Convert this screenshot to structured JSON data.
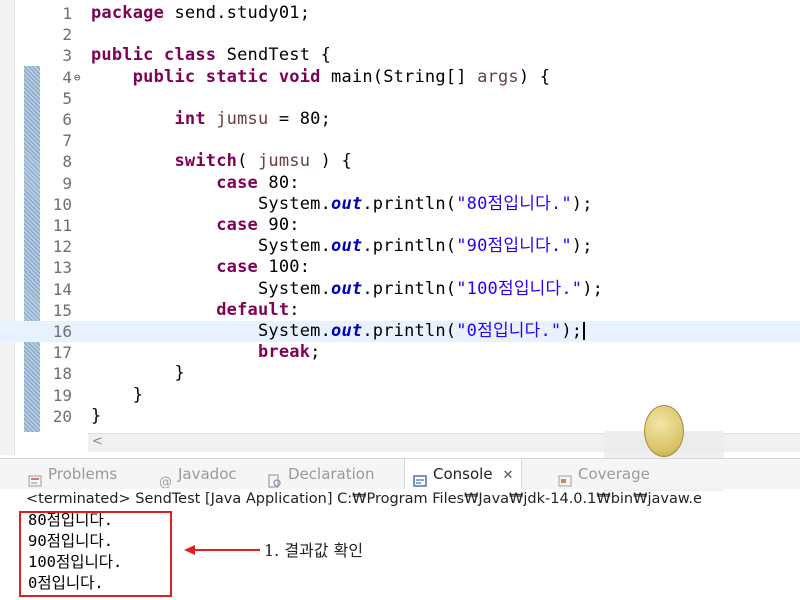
{
  "editor": {
    "lines": [
      {
        "n": "1",
        "segs": [
          {
            "t": "package ",
            "c": "kw"
          },
          {
            "t": "send.study01;",
            "c": ""
          }
        ]
      },
      {
        "n": "2",
        "segs": []
      },
      {
        "n": "3",
        "segs": [
          {
            "t": "public class ",
            "c": "kw"
          },
          {
            "t": "SendTest {",
            "c": ""
          }
        ]
      },
      {
        "n": "4",
        "fold": "⊖",
        "segs": [
          {
            "t": "    public static void ",
            "c": "kw"
          },
          {
            "t": "main(String[] ",
            "c": ""
          },
          {
            "t": "args",
            "c": "var"
          },
          {
            "t": ") {",
            "c": ""
          }
        ]
      },
      {
        "n": "5",
        "segs": []
      },
      {
        "n": "6",
        "segs": [
          {
            "t": "        int ",
            "c": "kw"
          },
          {
            "t": "jumsu",
            "c": "var"
          },
          {
            "t": " = 80;",
            "c": ""
          }
        ]
      },
      {
        "n": "7",
        "segs": []
      },
      {
        "n": "8",
        "segs": [
          {
            "t": "        switch",
            "c": "kw"
          },
          {
            "t": "( ",
            "c": ""
          },
          {
            "t": "jumsu",
            "c": "var"
          },
          {
            "t": " ) {",
            "c": ""
          }
        ]
      },
      {
        "n": "9",
        "segs": [
          {
            "t": "            case ",
            "c": "kw"
          },
          {
            "t": "80:",
            "c": ""
          }
        ]
      },
      {
        "n": "10",
        "segs": [
          {
            "t": "                System.",
            "c": ""
          },
          {
            "t": "out",
            "c": "fld"
          },
          {
            "t": ".println(",
            "c": ""
          },
          {
            "t": "\"80점입니다.\"",
            "c": "str"
          },
          {
            "t": ");",
            "c": ""
          }
        ]
      },
      {
        "n": "11",
        "segs": [
          {
            "t": "            case ",
            "c": "kw"
          },
          {
            "t": "90:",
            "c": ""
          }
        ]
      },
      {
        "n": "12",
        "segs": [
          {
            "t": "                System.",
            "c": ""
          },
          {
            "t": "out",
            "c": "fld"
          },
          {
            "t": ".println(",
            "c": ""
          },
          {
            "t": "\"90점입니다.\"",
            "c": "str"
          },
          {
            "t": ");",
            "c": ""
          }
        ]
      },
      {
        "n": "13",
        "segs": [
          {
            "t": "            case ",
            "c": "kw"
          },
          {
            "t": "100:",
            "c": ""
          }
        ]
      },
      {
        "n": "14",
        "segs": [
          {
            "t": "                System.",
            "c": ""
          },
          {
            "t": "out",
            "c": "fld"
          },
          {
            "t": ".println(",
            "c": ""
          },
          {
            "t": "\"100점입니다.\"",
            "c": "str"
          },
          {
            "t": ");",
            "c": ""
          }
        ]
      },
      {
        "n": "15",
        "segs": [
          {
            "t": "            default",
            "c": "kw"
          },
          {
            "t": ":",
            "c": ""
          }
        ]
      },
      {
        "n": "16",
        "current": true,
        "caret": true,
        "segs": [
          {
            "t": "                System.",
            "c": ""
          },
          {
            "t": "out",
            "c": "fld"
          },
          {
            "t": ".println(",
            "c": ""
          },
          {
            "t": "\"0점입니다.\"",
            "c": "str"
          },
          {
            "t": ");",
            "c": ""
          }
        ]
      },
      {
        "n": "17",
        "segs": [
          {
            "t": "                break",
            "c": "kw"
          },
          {
            "t": ";",
            "c": ""
          }
        ]
      },
      {
        "n": "18",
        "segs": [
          {
            "t": "        }",
            "c": ""
          }
        ]
      },
      {
        "n": "19",
        "segs": [
          {
            "t": "    }",
            "c": ""
          }
        ]
      },
      {
        "n": "20",
        "segs": [
          {
            "t": "}",
            "c": ""
          }
        ]
      }
    ],
    "scroll_left_glyph": "<"
  },
  "tabs": [
    {
      "key": "problems",
      "label": "Problems",
      "icon": "problems-icon",
      "active": false
    },
    {
      "key": "javadoc",
      "label": "Javadoc",
      "icon": "at-icon",
      "active": false
    },
    {
      "key": "declaration",
      "label": "Declaration",
      "icon": "declaration-icon",
      "active": false
    },
    {
      "key": "console",
      "label": "Console",
      "icon": "console-icon",
      "active": true,
      "close": "✕"
    },
    {
      "key": "coverage",
      "label": "Coverage",
      "icon": "coverage-icon",
      "active": false
    }
  ],
  "console": {
    "status": "<terminated> SendTest [Java Application] C:₩Program Files₩Java₩jdk-14.0.1₩bin₩javaw.e",
    "output": [
      "80점입니다.",
      "90점입니다.",
      "100점입니다.",
      "0점입니다."
    ]
  },
  "annotation": {
    "text": "1. 결과값 확인",
    "color": "#e02020"
  },
  "colors": {
    "keyword": "#7f0055",
    "string": "#2a00ff",
    "field": "#0000c0",
    "variable": "#6a3e3e",
    "highlight": "#e8f2fe",
    "annotation_box": "#e02020"
  }
}
